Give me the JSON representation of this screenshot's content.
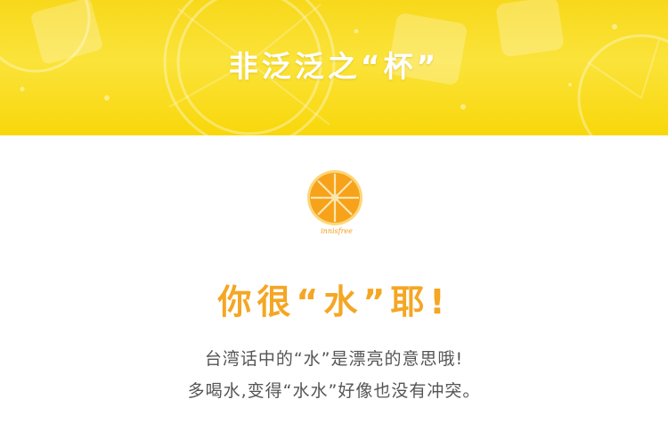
{
  "banner": {
    "title": "非泛泛之“杯”"
  },
  "logo": {
    "brand_text": "innisfree"
  },
  "content": {
    "headline": "你很“水”耶!",
    "line1": "台湾话中的“水”是漂亮的意思哦!",
    "line2": "多喝水,变得“水水”好像也没有冲突。"
  },
  "colors": {
    "banner": "#f9dc1f",
    "headline": "#f5a623",
    "body_text": "#555555",
    "orange": "#f7a21b"
  }
}
